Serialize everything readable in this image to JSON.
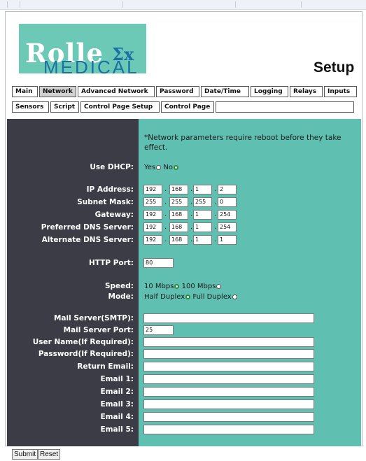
{
  "header": {
    "logo_line1": "Rolle",
    "logo_x": "Σx",
    "logo_line2": "MEDICAL",
    "title": "Setup"
  },
  "tabs_row1": [
    "Main",
    "Network",
    "Advanced Network",
    "Password",
    "Date/Time",
    "Logging",
    "Relays",
    "Inputs"
  ],
  "tabs_row2": [
    "Sensors",
    "Script",
    "Control Page Setup",
    "Control Page"
  ],
  "active_tab": "Network",
  "note": "*Network parameters require reboot before they take effect.",
  "dhcp": {
    "label": "Use DHCP:",
    "yes": "Yes",
    "no": "No",
    "selected": "No"
  },
  "ip": {
    "ip_address": {
      "label": "IP Address:",
      "octets": [
        "192",
        "168",
        "1",
        "2"
      ]
    },
    "subnet_mask": {
      "label": "Subnet Mask:",
      "octets": [
        "255",
        "255",
        "255",
        "0"
      ]
    },
    "gateway": {
      "label": "Gateway:",
      "octets": [
        "192",
        "168",
        "1",
        "254"
      ]
    },
    "preferred_dns": {
      "label": "Preferred DNS Server:",
      "octets": [
        "192",
        "168",
        "1",
        "254"
      ]
    },
    "alternate_dns": {
      "label": "Alternate DNS Server:",
      "octets": [
        "192",
        "168",
        "1",
        "1"
      ]
    }
  },
  "http_port": {
    "label": "HTTP Port:",
    "value": "80"
  },
  "speed": {
    "label": "Speed:",
    "opt1": "10 Mbps",
    "opt2": "100 Mbps",
    "selected": "10 Mbps"
  },
  "mode": {
    "label": "Mode:",
    "opt1": "Half Duplex",
    "opt2": "Full Duplex",
    "selected": "Half Duplex"
  },
  "mail": {
    "smtp_label": "Mail Server(SMTP):",
    "smtp_value": "",
    "port_label": "Mail Server Port:",
    "port_value": "25",
    "user_label": "User Name(If Required):",
    "user_value": "",
    "password_label": "Password(If Required):",
    "password_value": "",
    "return_label": "Return Email:",
    "return_value": "",
    "email1_label": "Email 1:",
    "email2_label": "Email 2:",
    "email3_label": "Email 3:",
    "email4_label": "Email 4:",
    "email5_label": "Email 5:"
  },
  "buttons": {
    "submit": "Submit",
    "reset": "Reset"
  },
  "colors": {
    "teal": "#5fbfb0",
    "dark_band": "#3b3c46",
    "logo_bg": "#6bc9b6",
    "logo_blue": "#1a6fa3"
  }
}
